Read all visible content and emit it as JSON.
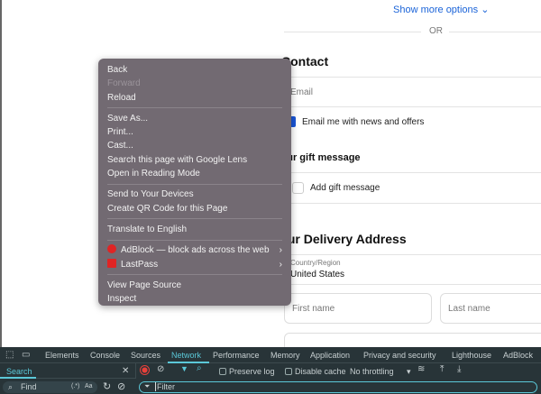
{
  "page": {
    "show_more_options": "Show more options",
    "or": "OR",
    "contact_heading": "Contact",
    "email_placeholder": "Email",
    "email_optin_label": "Email me with news and offers",
    "gift_heading": "Your gift message",
    "gift_label": "Add gift message",
    "delivery_heading": "Your Delivery Address",
    "country_label": "Country/Region",
    "country_value": "United States",
    "first_name_placeholder": "First name",
    "last_name_placeholder": "Last name"
  },
  "context_menu": {
    "items": [
      {
        "label": "Back"
      },
      {
        "label": "Forward",
        "disabled": true
      },
      {
        "label": "Reload"
      },
      {
        "label": "Save As..."
      },
      {
        "label": "Print..."
      },
      {
        "label": "Cast..."
      },
      {
        "label": "Search this page with Google Lens"
      },
      {
        "label": "Open in Reading Mode"
      },
      {
        "label": "Send to Your Devices"
      },
      {
        "label": "Create QR Code for this Page"
      },
      {
        "label": "Translate to English"
      },
      {
        "label": "AdBlock — block ads across the web",
        "icon": "adblock-icon"
      },
      {
        "label": "LastPass",
        "icon": "lastpass-icon"
      },
      {
        "label": "View Page Source"
      },
      {
        "label": "Inspect"
      }
    ]
  },
  "devtools": {
    "tabs": [
      "Elements",
      "Console",
      "Sources",
      "Network",
      "Performance",
      "Memory",
      "Application",
      "Privacy and security",
      "Lighthouse",
      "AdBlock"
    ],
    "active_tab": "Network",
    "search_tab": "Search",
    "find_placeholder": "Find",
    "regex": "(.*)",
    "match_case": "Aa",
    "preserve_log": "Preserve log",
    "disable_cache": "Disable cache",
    "throttling": "No throttling",
    "filter_placeholder": "Filter"
  },
  "colors": {
    "accent": "#5bc8d8",
    "link": "#1a63d8",
    "menu_bg": "#726a72",
    "devtools_bg": "#283438",
    "record": "#e8403a"
  }
}
